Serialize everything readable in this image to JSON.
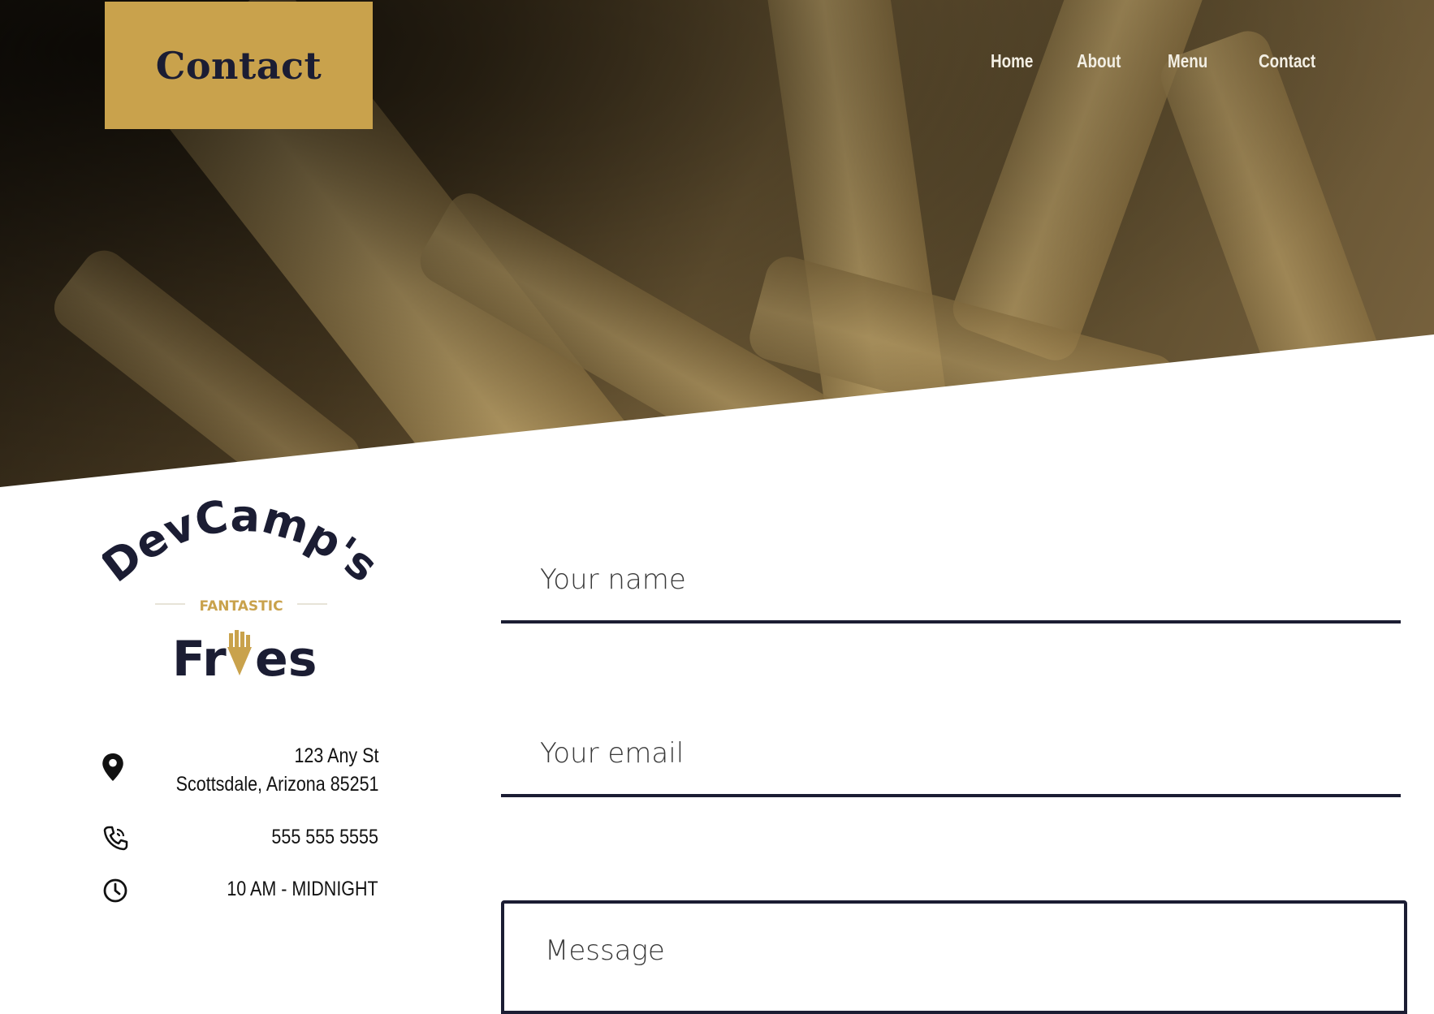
{
  "page": {
    "title_badge": "Contact"
  },
  "nav": {
    "items": [
      "Home",
      "About",
      "Menu",
      "Contact"
    ]
  },
  "logo": {
    "top_text": "DevCamp's",
    "middle_text": "FANTASTIC",
    "bottom_text_start": "Fr",
    "bottom_text_end": "es"
  },
  "contact_info": {
    "address_line1": "123 Any St",
    "address_line2": "Scottsdale, Arizona 85251",
    "phone": "555 555 5555",
    "hours": "10 AM - MIDNIGHT",
    "icons": [
      "location-pin-icon",
      "phone-icon",
      "clock-icon"
    ]
  },
  "form": {
    "name_placeholder": "Your name",
    "email_placeholder": "Your email",
    "message_placeholder": "Message"
  },
  "colors": {
    "accent_gold": "#c9a24c",
    "navy": "#1b1d33"
  }
}
